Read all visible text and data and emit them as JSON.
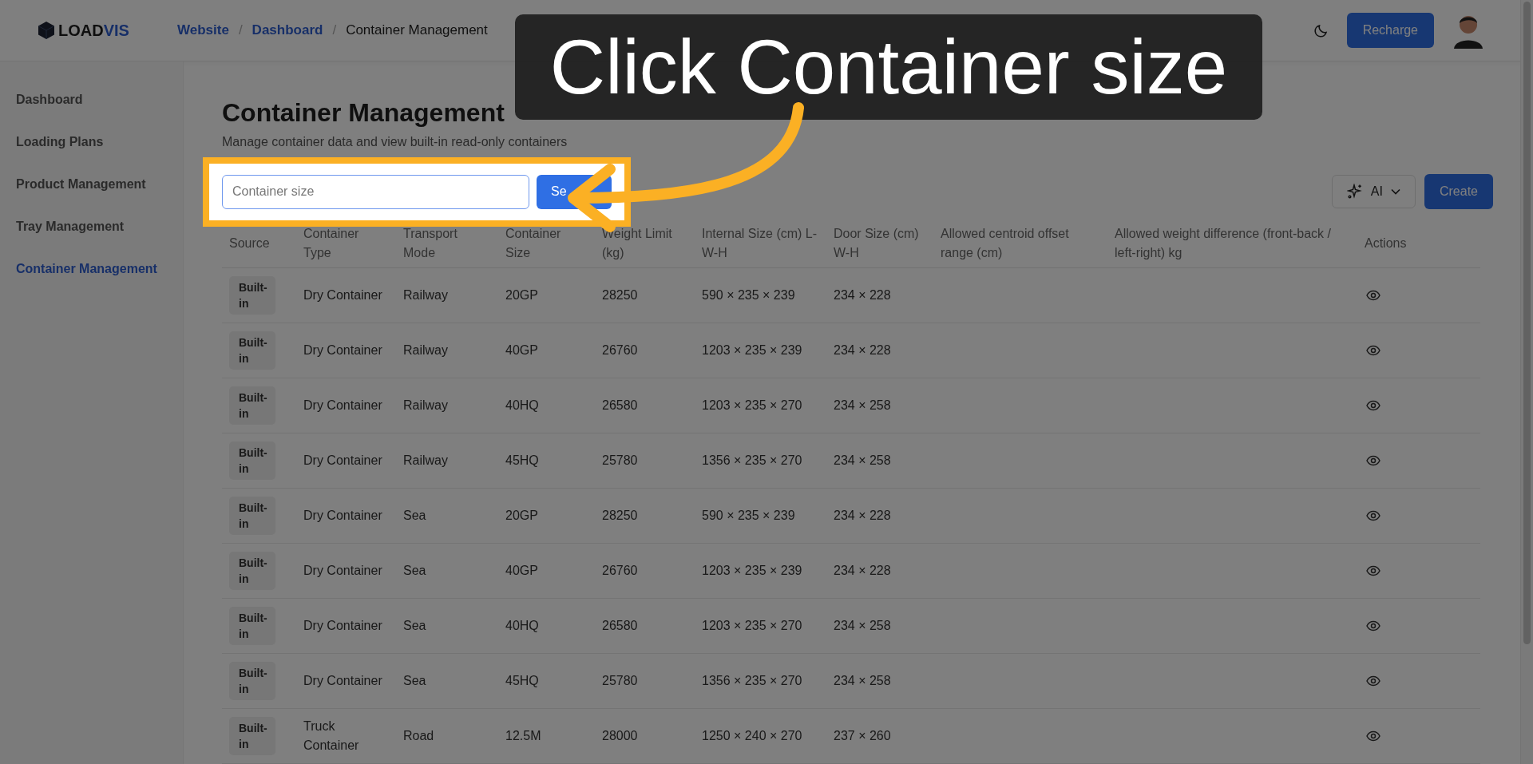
{
  "header": {
    "logo": {
      "parts": [
        {
          "text": "LOAD",
          "accent": false
        },
        {
          "text": "VIS",
          "accent": true
        }
      ]
    },
    "breadcrumb": [
      {
        "label": "Website",
        "link": true
      },
      {
        "label": "Dashboard",
        "link": true
      },
      {
        "label": "Container Management",
        "link": false
      }
    ],
    "breadcrumb_separators": [
      "/",
      "/"
    ],
    "recharge_button": "Recharge"
  },
  "sidebar": {
    "items": [
      {
        "label": "Dashboard",
        "selected": false
      },
      {
        "label": "Loading Plans",
        "selected": false
      },
      {
        "label": "Product Management",
        "selected": false
      },
      {
        "label": "Tray Management",
        "selected": false
      },
      {
        "label": "Container Management",
        "selected": true
      }
    ]
  },
  "page": {
    "title": "Container Management",
    "subtitle": "Manage container data and view built-in read-only containers",
    "search": {
      "placeholder": "Container size"
    },
    "search_button": "Se",
    "ai_button": "AI",
    "create_button": "Create"
  },
  "table": {
    "columns": [
      "Source",
      "Container Type",
      "Transport Mode",
      "Container Size",
      "Weight Limit (kg)",
      "Internal Size (cm) L-W-H",
      "Door Size (cm) W-H",
      "Allowed centroid offset range (cm)",
      "Allowed weight difference (front-back / left-right) kg",
      "Actions"
    ],
    "rows": [
      {
        "source": "Built-in",
        "type": "Dry Container",
        "mode": "Railway",
        "size": "20GP",
        "weight": "28250",
        "internal": "590 × 235 × 239",
        "door": "234 × 228"
      },
      {
        "source": "Built-in",
        "type": "Dry Container",
        "mode": "Railway",
        "size": "40GP",
        "weight": "26760",
        "internal": "1203 × 235 × 239",
        "door": "234 × 228"
      },
      {
        "source": "Built-in",
        "type": "Dry Container",
        "mode": "Railway",
        "size": "40HQ",
        "weight": "26580",
        "internal": "1203 × 235 × 270",
        "door": "234 × 258"
      },
      {
        "source": "Built-in",
        "type": "Dry Container",
        "mode": "Railway",
        "size": "45HQ",
        "weight": "25780",
        "internal": "1356 × 235 × 270",
        "door": "234 × 258"
      },
      {
        "source": "Built-in",
        "type": "Dry Container",
        "mode": "Sea",
        "size": "20GP",
        "weight": "28250",
        "internal": "590 × 235 × 239",
        "door": "234 × 228"
      },
      {
        "source": "Built-in",
        "type": "Dry Container",
        "mode": "Sea",
        "size": "40GP",
        "weight": "26760",
        "internal": "1203 × 235 × 239",
        "door": "234 × 228"
      },
      {
        "source": "Built-in",
        "type": "Dry Container",
        "mode": "Sea",
        "size": "40HQ",
        "weight": "26580",
        "internal": "1203 × 235 × 270",
        "door": "234 × 258"
      },
      {
        "source": "Built-in",
        "type": "Dry Container",
        "mode": "Sea",
        "size": "45HQ",
        "weight": "25780",
        "internal": "1356 × 235 × 270",
        "door": "234 × 258"
      },
      {
        "source": "Built-in",
        "type": "Truck Container",
        "mode": "Road",
        "size": "12.5M",
        "weight": "28000",
        "internal": "1250 × 240 × 270",
        "door": "237 × 260"
      }
    ]
  },
  "tutorial": {
    "callout": "Click Container size"
  }
}
